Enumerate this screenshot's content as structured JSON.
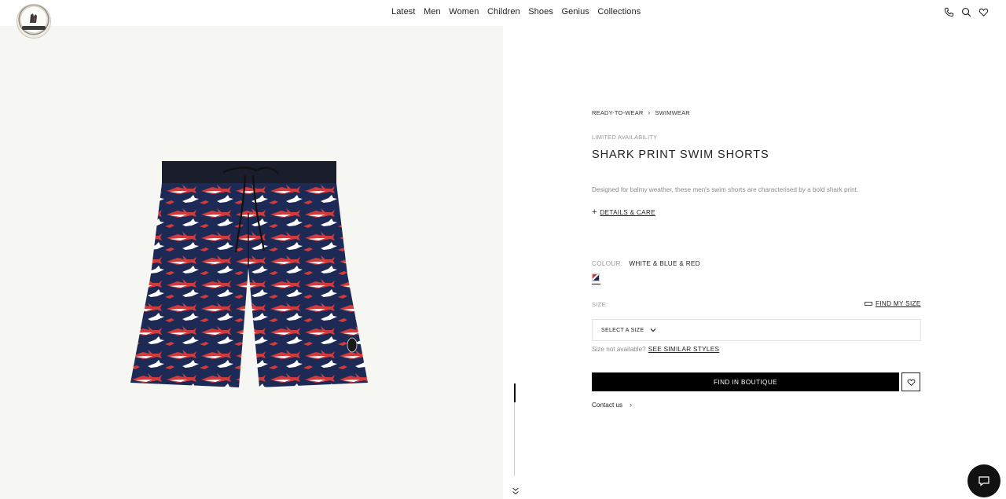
{
  "header": {
    "logo_alt": "MONCLER",
    "nav": [
      "Latest",
      "Men",
      "Women",
      "Children",
      "Shoes",
      "Genius",
      "Collections"
    ],
    "icons": [
      "phone-icon",
      "search-icon",
      "heart-icon"
    ]
  },
  "product": {
    "breadcrumb": [
      "READY-TO-WEAR",
      "SWIMWEAR"
    ],
    "breadcrumb_separator": "›",
    "availability": "LIMITED AVAILABILITY",
    "title": "SHARK PRINT SWIM SHORTS",
    "description": "Designed for balmy weather, these men's swim shorts are characterised by a bold shark print.",
    "details_toggle": "+",
    "details_link": "DETAILS & CARE",
    "colour_label": "COLOUR:",
    "colour_value": "WHITE & BLUE & RED",
    "size_label": "SIZE:",
    "find_size_link": "FIND MY SIZE",
    "size_select": "SELECT A SIZE",
    "size_unavailable": "Size not available?",
    "similar_link": "SEE SIMILAR STYLES",
    "boutique_button": "FIND IN BOUTIQUE",
    "contact": "Contact us",
    "contact_arrow": "›"
  },
  "colors": {
    "accent": "#000000",
    "image_bg": "#f6f6f2",
    "print_navy": "#1d2a55",
    "print_red": "#d23b3b"
  }
}
